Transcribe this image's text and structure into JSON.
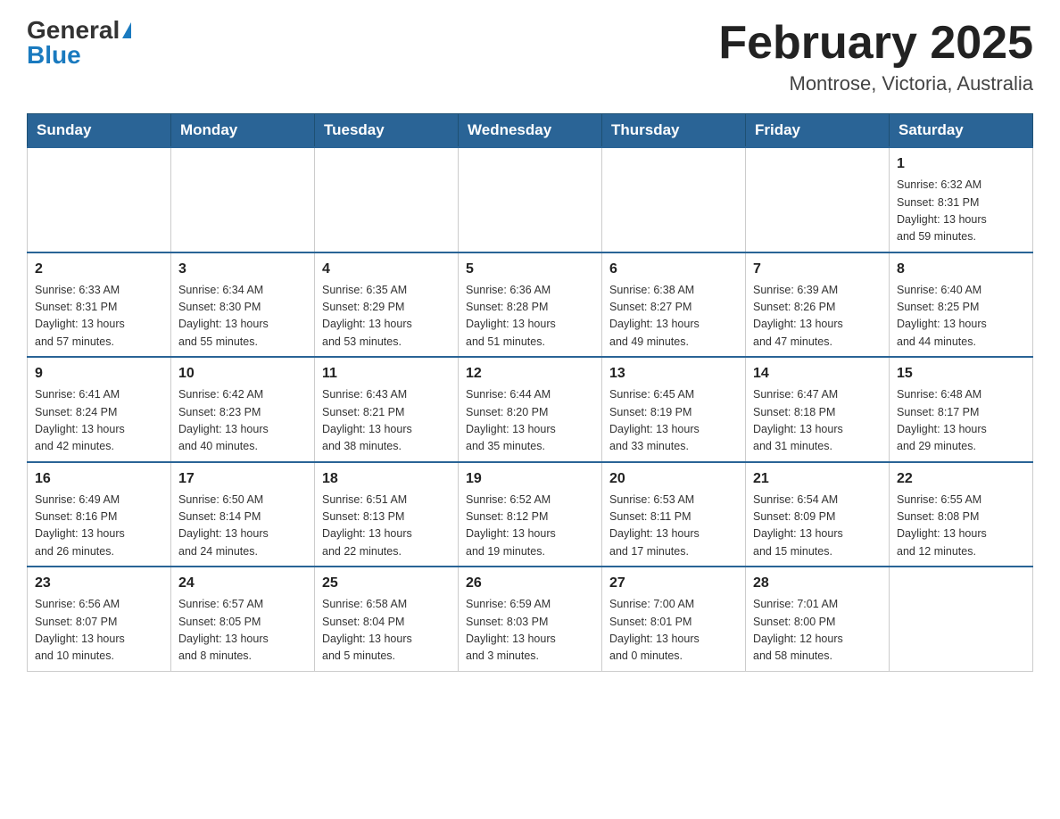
{
  "header": {
    "logo_general": "General",
    "logo_blue": "Blue",
    "month_title": "February 2025",
    "location": "Montrose, Victoria, Australia"
  },
  "weekdays": [
    "Sunday",
    "Monday",
    "Tuesday",
    "Wednesday",
    "Thursday",
    "Friday",
    "Saturday"
  ],
  "weeks": [
    [
      {
        "day": "",
        "info": ""
      },
      {
        "day": "",
        "info": ""
      },
      {
        "day": "",
        "info": ""
      },
      {
        "day": "",
        "info": ""
      },
      {
        "day": "",
        "info": ""
      },
      {
        "day": "",
        "info": ""
      },
      {
        "day": "1",
        "info": "Sunrise: 6:32 AM\nSunset: 8:31 PM\nDaylight: 13 hours\nand 59 minutes."
      }
    ],
    [
      {
        "day": "2",
        "info": "Sunrise: 6:33 AM\nSunset: 8:31 PM\nDaylight: 13 hours\nand 57 minutes."
      },
      {
        "day": "3",
        "info": "Sunrise: 6:34 AM\nSunset: 8:30 PM\nDaylight: 13 hours\nand 55 minutes."
      },
      {
        "day": "4",
        "info": "Sunrise: 6:35 AM\nSunset: 8:29 PM\nDaylight: 13 hours\nand 53 minutes."
      },
      {
        "day": "5",
        "info": "Sunrise: 6:36 AM\nSunset: 8:28 PM\nDaylight: 13 hours\nand 51 minutes."
      },
      {
        "day": "6",
        "info": "Sunrise: 6:38 AM\nSunset: 8:27 PM\nDaylight: 13 hours\nand 49 minutes."
      },
      {
        "day": "7",
        "info": "Sunrise: 6:39 AM\nSunset: 8:26 PM\nDaylight: 13 hours\nand 47 minutes."
      },
      {
        "day": "8",
        "info": "Sunrise: 6:40 AM\nSunset: 8:25 PM\nDaylight: 13 hours\nand 44 minutes."
      }
    ],
    [
      {
        "day": "9",
        "info": "Sunrise: 6:41 AM\nSunset: 8:24 PM\nDaylight: 13 hours\nand 42 minutes."
      },
      {
        "day": "10",
        "info": "Sunrise: 6:42 AM\nSunset: 8:23 PM\nDaylight: 13 hours\nand 40 minutes."
      },
      {
        "day": "11",
        "info": "Sunrise: 6:43 AM\nSunset: 8:21 PM\nDaylight: 13 hours\nand 38 minutes."
      },
      {
        "day": "12",
        "info": "Sunrise: 6:44 AM\nSunset: 8:20 PM\nDaylight: 13 hours\nand 35 minutes."
      },
      {
        "day": "13",
        "info": "Sunrise: 6:45 AM\nSunset: 8:19 PM\nDaylight: 13 hours\nand 33 minutes."
      },
      {
        "day": "14",
        "info": "Sunrise: 6:47 AM\nSunset: 8:18 PM\nDaylight: 13 hours\nand 31 minutes."
      },
      {
        "day": "15",
        "info": "Sunrise: 6:48 AM\nSunset: 8:17 PM\nDaylight: 13 hours\nand 29 minutes."
      }
    ],
    [
      {
        "day": "16",
        "info": "Sunrise: 6:49 AM\nSunset: 8:16 PM\nDaylight: 13 hours\nand 26 minutes."
      },
      {
        "day": "17",
        "info": "Sunrise: 6:50 AM\nSunset: 8:14 PM\nDaylight: 13 hours\nand 24 minutes."
      },
      {
        "day": "18",
        "info": "Sunrise: 6:51 AM\nSunset: 8:13 PM\nDaylight: 13 hours\nand 22 minutes."
      },
      {
        "day": "19",
        "info": "Sunrise: 6:52 AM\nSunset: 8:12 PM\nDaylight: 13 hours\nand 19 minutes."
      },
      {
        "day": "20",
        "info": "Sunrise: 6:53 AM\nSunset: 8:11 PM\nDaylight: 13 hours\nand 17 minutes."
      },
      {
        "day": "21",
        "info": "Sunrise: 6:54 AM\nSunset: 8:09 PM\nDaylight: 13 hours\nand 15 minutes."
      },
      {
        "day": "22",
        "info": "Sunrise: 6:55 AM\nSunset: 8:08 PM\nDaylight: 13 hours\nand 12 minutes."
      }
    ],
    [
      {
        "day": "23",
        "info": "Sunrise: 6:56 AM\nSunset: 8:07 PM\nDaylight: 13 hours\nand 10 minutes."
      },
      {
        "day": "24",
        "info": "Sunrise: 6:57 AM\nSunset: 8:05 PM\nDaylight: 13 hours\nand 8 minutes."
      },
      {
        "day": "25",
        "info": "Sunrise: 6:58 AM\nSunset: 8:04 PM\nDaylight: 13 hours\nand 5 minutes."
      },
      {
        "day": "26",
        "info": "Sunrise: 6:59 AM\nSunset: 8:03 PM\nDaylight: 13 hours\nand 3 minutes."
      },
      {
        "day": "27",
        "info": "Sunrise: 7:00 AM\nSunset: 8:01 PM\nDaylight: 13 hours\nand 0 minutes."
      },
      {
        "day": "28",
        "info": "Sunrise: 7:01 AM\nSunset: 8:00 PM\nDaylight: 12 hours\nand 58 minutes."
      },
      {
        "day": "",
        "info": ""
      }
    ]
  ]
}
